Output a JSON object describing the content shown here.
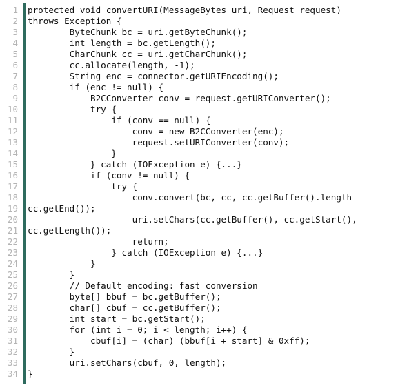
{
  "document": {
    "kind": "source-code-listing",
    "language": "Java",
    "background_color": "#ffffff",
    "gutter_divider_color": "#2e6b5e",
    "line_number_color": "#b4b4b4",
    "code_text_color": "#111111",
    "first_line_number": 1,
    "last_line_number": 34
  },
  "lines": [
    {
      "number": "1",
      "code": "protected void convertURI(MessageBytes uri, Request request)"
    },
    {
      "number": "2",
      "code": "throws Exception {"
    },
    {
      "number": "3",
      "code": "        ByteChunk bc = uri.getByteChunk();"
    },
    {
      "number": "4",
      "code": "        int length = bc.getLength();"
    },
    {
      "number": "5",
      "code": "        CharChunk cc = uri.getCharChunk();"
    },
    {
      "number": "6",
      "code": "        cc.allocate(length, -1);"
    },
    {
      "number": "7",
      "code": "        String enc = connector.getURIEncoding();"
    },
    {
      "number": "8",
      "code": "        if (enc != null) {"
    },
    {
      "number": "9",
      "code": "            B2CConverter conv = request.getURIConverter();"
    },
    {
      "number": "10",
      "code": "            try {"
    },
    {
      "number": "11",
      "code": "                if (conv == null) {"
    },
    {
      "number": "12",
      "code": "                    conv = new B2CConverter(enc);"
    },
    {
      "number": "13",
      "code": "                    request.setURIConverter(conv);"
    },
    {
      "number": "14",
      "code": "                }"
    },
    {
      "number": "15",
      "code": "            } catch (IOException e) {...}"
    },
    {
      "number": "16",
      "code": "            if (conv != null) {"
    },
    {
      "number": "17",
      "code": "                try {"
    },
    {
      "number": "18",
      "code": "                    conv.convert(bc, cc, cc.getBuffer().length -"
    },
    {
      "number": "19",
      "code": "cc.getEnd());"
    },
    {
      "number": "20",
      "code": "                    uri.setChars(cc.getBuffer(), cc.getStart(),"
    },
    {
      "number": "21",
      "code": "cc.getLength());"
    },
    {
      "number": "22",
      "code": "                    return;"
    },
    {
      "number": "23",
      "code": "                } catch (IOException e) {...}"
    },
    {
      "number": "24",
      "code": "            }"
    },
    {
      "number": "25",
      "code": "        }"
    },
    {
      "number": "26",
      "code": "        // Default encoding: fast conversion"
    },
    {
      "number": "27",
      "code": "        byte[] bbuf = bc.getBuffer();"
    },
    {
      "number": "28",
      "code": "        char[] cbuf = cc.getBuffer();"
    },
    {
      "number": "29",
      "code": "        int start = bc.getStart();"
    },
    {
      "number": "30",
      "code": "        for (int i = 0; i < length; i++) {"
    },
    {
      "number": "31",
      "code": "            cbuf[i] = (char) (bbuf[i + start] & 0xff);"
    },
    {
      "number": "32",
      "code": "        }"
    },
    {
      "number": "33",
      "code": "        uri.setChars(cbuf, 0, length);"
    },
    {
      "number": "34",
      "code": "}"
    }
  ]
}
